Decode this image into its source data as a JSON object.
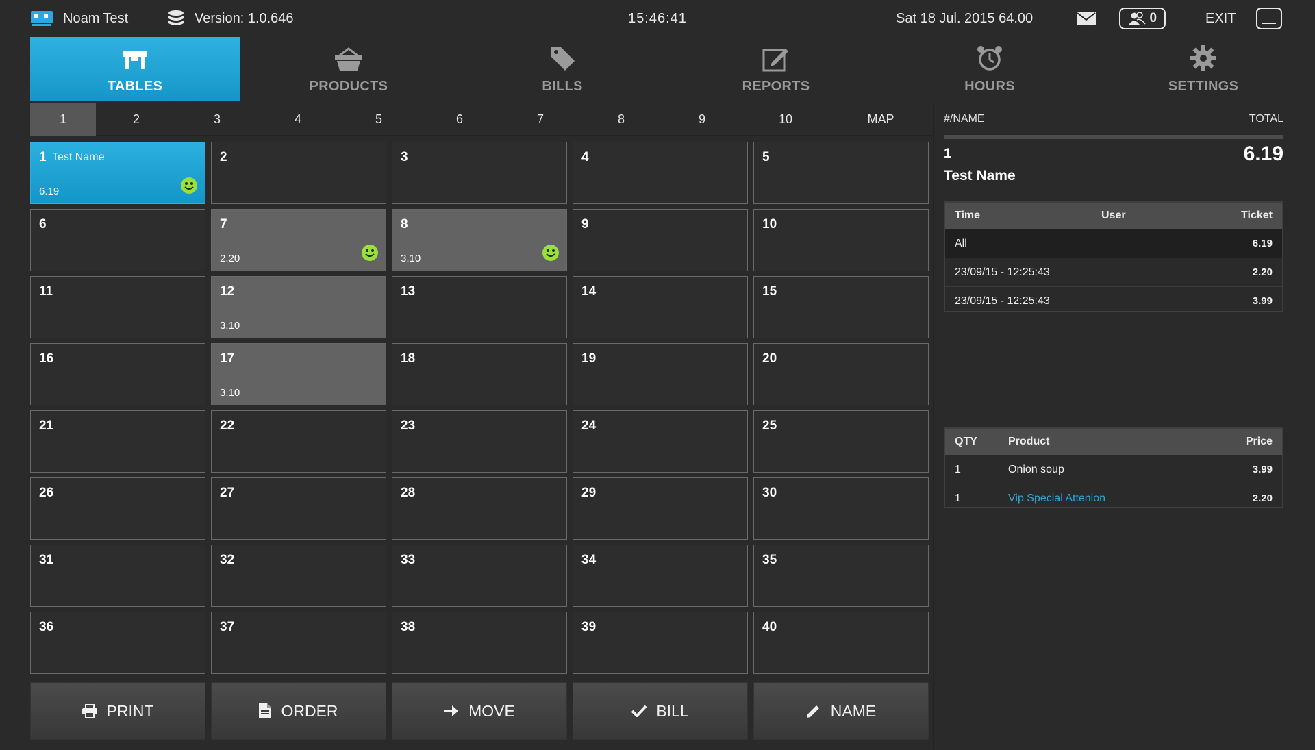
{
  "topbar": {
    "user": "Noam Test",
    "version": "Version: 1.0.646",
    "clock": "15:46:41",
    "date": "Sat 18 Jul. 2015 64.00",
    "users_count": "0",
    "exit": "EXIT"
  },
  "nav": [
    {
      "label": "TABLES",
      "icon": "table-icon",
      "active": true
    },
    {
      "label": "PRODUCTS",
      "icon": "basket-icon"
    },
    {
      "label": "BILLS",
      "icon": "tag-icon"
    },
    {
      "label": "REPORTS",
      "icon": "edit-icon"
    },
    {
      "label": "HOURS",
      "icon": "alarm-clock-icon"
    },
    {
      "label": "SETTINGS",
      "icon": "gear-icon"
    }
  ],
  "pages": [
    "1",
    "2",
    "3",
    "4",
    "5",
    "6",
    "7",
    "8",
    "9",
    "10",
    "MAP"
  ],
  "active_page": "1",
  "tables": [
    {
      "num": "1",
      "name": "Test Name",
      "amount": "6.19",
      "state": "selected",
      "smiley": true
    },
    {
      "num": "2"
    },
    {
      "num": "3"
    },
    {
      "num": "4"
    },
    {
      "num": "5"
    },
    {
      "num": "6"
    },
    {
      "num": "7",
      "amount": "2.20",
      "state": "occupied",
      "smiley": true
    },
    {
      "num": "8",
      "amount": "3.10",
      "state": "occupied",
      "smiley": true
    },
    {
      "num": "9"
    },
    {
      "num": "10"
    },
    {
      "num": "11"
    },
    {
      "num": "12",
      "amount": "3.10",
      "state": "occupied"
    },
    {
      "num": "13"
    },
    {
      "num": "14"
    },
    {
      "num": "15"
    },
    {
      "num": "16"
    },
    {
      "num": "17",
      "amount": "3.10",
      "state": "occupied"
    },
    {
      "num": "18"
    },
    {
      "num": "19"
    },
    {
      "num": "20"
    },
    {
      "num": "21"
    },
    {
      "num": "22"
    },
    {
      "num": "23"
    },
    {
      "num": "24"
    },
    {
      "num": "25"
    },
    {
      "num": "26"
    },
    {
      "num": "27"
    },
    {
      "num": "28"
    },
    {
      "num": "29"
    },
    {
      "num": "30"
    },
    {
      "num": "31"
    },
    {
      "num": "32"
    },
    {
      "num": "33"
    },
    {
      "num": "34"
    },
    {
      "num": "35"
    },
    {
      "num": "36"
    },
    {
      "num": "37"
    },
    {
      "num": "38"
    },
    {
      "num": "39"
    },
    {
      "num": "40"
    }
  ],
  "actions": [
    {
      "label": "PRINT",
      "icon": "printer-icon"
    },
    {
      "label": "ORDER",
      "icon": "document-icon"
    },
    {
      "label": "MOVE",
      "icon": "arrow-right-icon"
    },
    {
      "label": "BILL",
      "icon": "checkmark-icon"
    },
    {
      "label": "NAME",
      "icon": "pencil-icon"
    }
  ],
  "panel": {
    "header_name": "#/NAME",
    "header_total": "TOTAL",
    "selected_num": "1",
    "selected_total": "6.19",
    "selected_name": "Test Name",
    "tickets": {
      "headers": {
        "time": "Time",
        "user": "User",
        "ticket": "Ticket"
      },
      "rows": [
        {
          "time": "All",
          "user": "",
          "ticket": "6.19"
        },
        {
          "time": "23/09/15 - 12:25:43",
          "user": "",
          "ticket": "2.20"
        },
        {
          "time": "23/09/15 - 12:25:43",
          "user": "",
          "ticket": "3.99"
        }
      ]
    },
    "products": {
      "headers": {
        "qty": "QTY",
        "product": "Product",
        "price": "Price"
      },
      "rows": [
        {
          "qty": "1",
          "product": "Onion soup",
          "price": "3.99"
        },
        {
          "qty": "1",
          "product": "Vip Special Attenion",
          "price": "2.20",
          "highlight": true
        }
      ]
    }
  },
  "colors": {
    "accent": "#1fa5d6",
    "smiley": "#9be03a",
    "highlight": "#2fa6d8"
  }
}
